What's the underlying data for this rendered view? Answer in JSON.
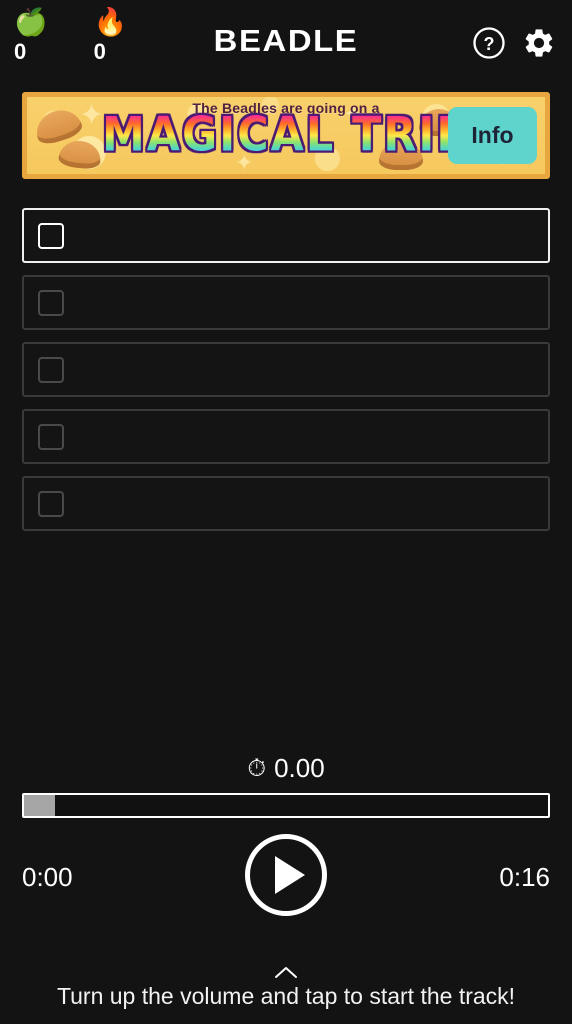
{
  "app": {
    "title": "BEADLE",
    "background_color": "#131313"
  },
  "header": {
    "stats": [
      {
        "icon": "green-apple-emoji",
        "glyph": "🍏",
        "value": "0"
      },
      {
        "icon": "fire-emoji",
        "glyph": "🔥",
        "value": "0"
      }
    ],
    "icons": [
      {
        "name": "help-icon",
        "label": "?"
      },
      {
        "name": "settings-gear-icon",
        "label": "Settings"
      }
    ]
  },
  "banner": {
    "subtitle": "The Beadles are going on a",
    "title": "MAGICAL TRIP",
    "info_label": "Info",
    "border_color": "#e8a63f",
    "background_color": "#f8d06b",
    "info_button_color": "#5ed4cd",
    "subtitle_color": "#51213f"
  },
  "guesses": {
    "rows": [
      {
        "index": 1,
        "state": "active",
        "text": ""
      },
      {
        "index": 2,
        "state": "inactive",
        "text": ""
      },
      {
        "index": 3,
        "state": "inactive",
        "text": ""
      },
      {
        "index": 4,
        "state": "inactive",
        "text": ""
      },
      {
        "index": 5,
        "state": "inactive",
        "text": ""
      }
    ],
    "active_border_color": "#f0f0f0",
    "inactive_border_color": "#3a3a3a"
  },
  "player": {
    "timer_icon": "⏱",
    "timer_value": "0.00",
    "progress_percent": 6,
    "current_time": "0:00",
    "total_time": "0:16",
    "play_label": "Play",
    "fill_color": "#a6a6a6"
  },
  "footer": {
    "chevron": "chevron-up-icon",
    "message": "Turn up the volume and tap to start the track!"
  }
}
